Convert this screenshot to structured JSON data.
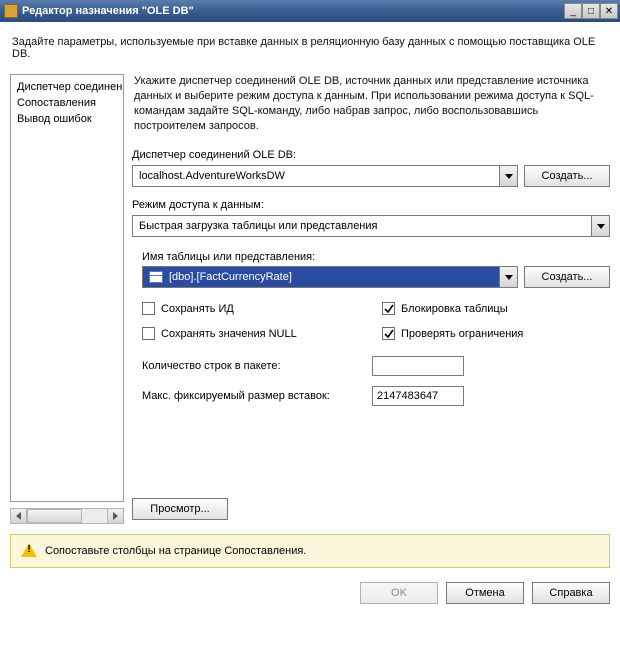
{
  "window": {
    "title": "Редактор назначения \"OLE DB\""
  },
  "page": {
    "subtitle": "Задайте параметры, используемые при вставке данных в реляционную базу данных с помощью поставщика OLE DB."
  },
  "sidebar": {
    "items": [
      {
        "label": "Диспетчер соединений"
      },
      {
        "label": "Сопоставления"
      },
      {
        "label": "Вывод ошибок"
      }
    ]
  },
  "main": {
    "intro": "Укажите диспетчер соединений OLE DB, источник данных или представление источника данных и выберите режим доступа к данным. При использовании режима доступа к SQL-командам задайте SQL-команду, либо набрав запрос, либо воспользовавшись построителем запросов.",
    "conn_label": "Диспетчер соединений OLE DB:",
    "conn_value": "localhost.AdventureWorksDW",
    "create_btn": "Создать...",
    "mode_label": "Режим доступа к данным:",
    "mode_value": "Быстрая загрузка таблицы или представления",
    "table_label": "Имя таблицы или представления:",
    "table_value": "[dbo].[FactCurrencyRate]",
    "checks": {
      "keep_id": {
        "label": "Сохранять ИД",
        "checked": false
      },
      "keep_null": {
        "label": "Сохранять значения NULL",
        "checked": false
      },
      "lock_table": {
        "label": "Блокировка таблицы",
        "checked": true
      },
      "check_constraints": {
        "label": "Проверять ограничения",
        "checked": true
      }
    },
    "rows_batch_label": "Количество строк в пакете:",
    "rows_batch_value": "",
    "max_commit_label": "Макс. фиксируемый размер вставок:",
    "max_commit_value": "2147483647",
    "preview_btn": "Просмотр..."
  },
  "warning": {
    "text": "Сопоставьте столбцы на странице Сопоставления."
  },
  "footer": {
    "ok": "OK",
    "cancel": "Отмена",
    "help": "Справка"
  }
}
